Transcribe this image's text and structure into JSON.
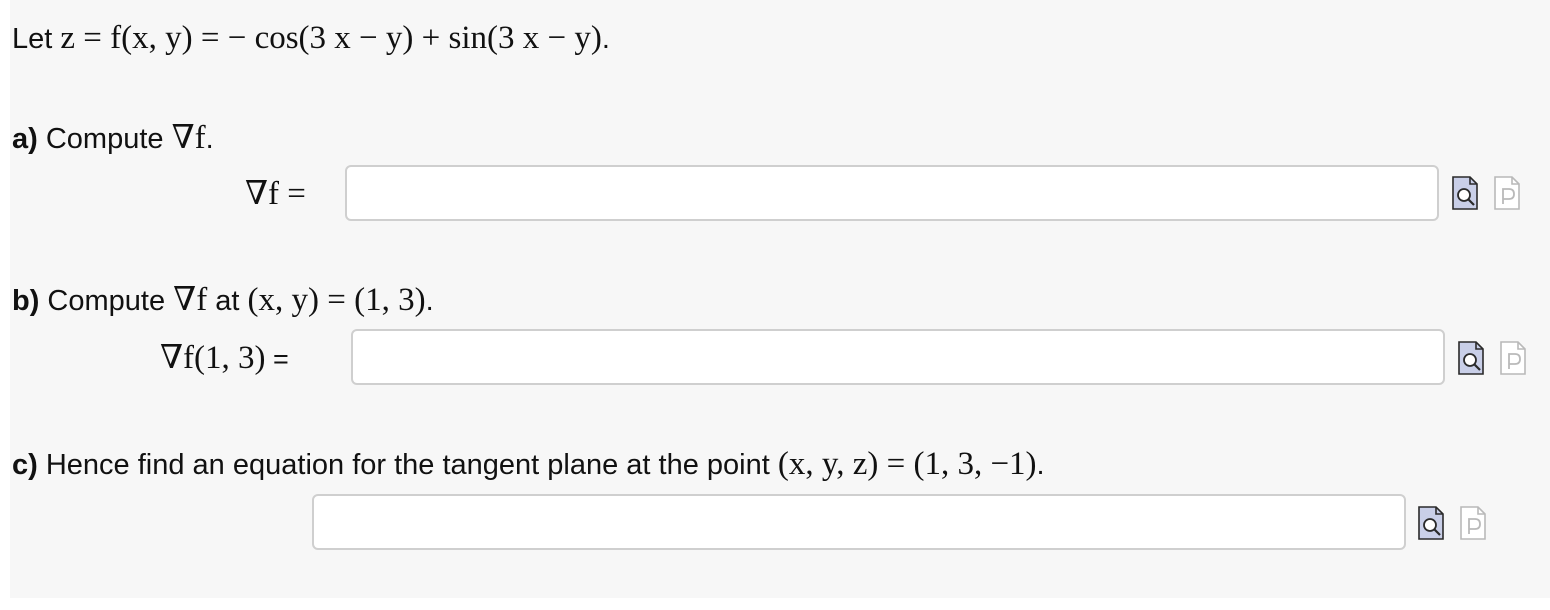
{
  "intro": {
    "lead": "Let ",
    "math": "z = f(x, y) = − cos(3 x − y) + sin(3 x − y)",
    "tail": "."
  },
  "parts": [
    {
      "part_label": "a)",
      "text": " Compute ",
      "math": "∇f",
      "tail": ".",
      "answer_label_math": "∇f =",
      "answer_label_eq": "",
      "input_value": "",
      "preview_icon": "preview-formula-icon",
      "syntax_icon": "syntax-help-icon"
    },
    {
      "part_label": "b)",
      "text": " Compute ",
      "math": "∇f",
      "text2": " at ",
      "math2": "(x, y) = (1, 3)",
      "tail": ".",
      "answer_label_math": "∇f(1, 3)",
      "answer_label_eq": " =",
      "input_value": "",
      "preview_icon": "preview-formula-icon",
      "syntax_icon": "syntax-help-icon"
    },
    {
      "part_label": "c)",
      "text": " Hence find an equation for the tangent plane at the point ",
      "math": "(x, y, z) = (1, 3, −1)",
      "tail": ".",
      "input_value": "",
      "preview_icon": "preview-formula-icon",
      "syntax_icon": "syntax-help-icon"
    }
  ],
  "colors": {
    "panel_background": "#f7f7f7",
    "input_border": "#cfcfcf",
    "preview_icon_fill": "#c9cfe8",
    "preview_icon_stroke": "#2a2a2a",
    "syntax_icon_stroke": "#b9b9b9"
  }
}
